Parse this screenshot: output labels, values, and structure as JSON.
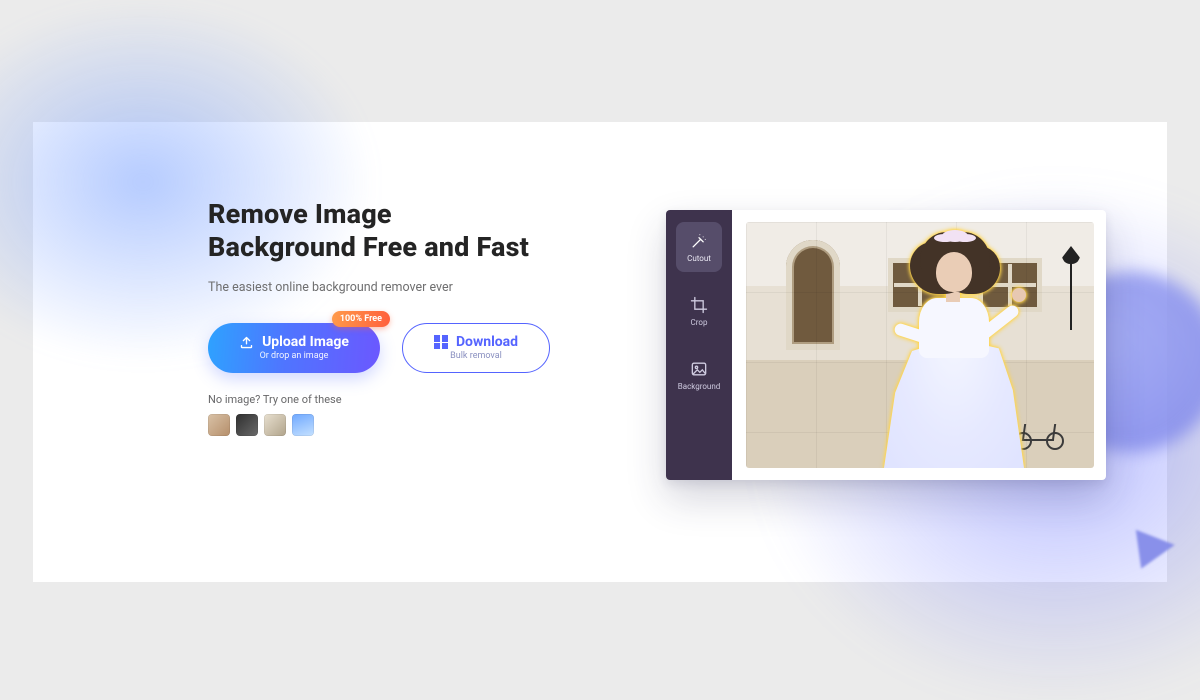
{
  "hero": {
    "title_line1": "Remove Image",
    "title_line2": "Background Free and Fast",
    "subtitle": "The easiest online background remover ever"
  },
  "upload": {
    "badge": "100% Free",
    "label": "Upload Image",
    "sub": "Or drop an image"
  },
  "download": {
    "label": "Download",
    "sub": "Bulk removal"
  },
  "samples": {
    "prompt": "No image? Try one of these"
  },
  "tools": {
    "cutout": "Cutout",
    "crop": "Crop",
    "background": "Background"
  }
}
